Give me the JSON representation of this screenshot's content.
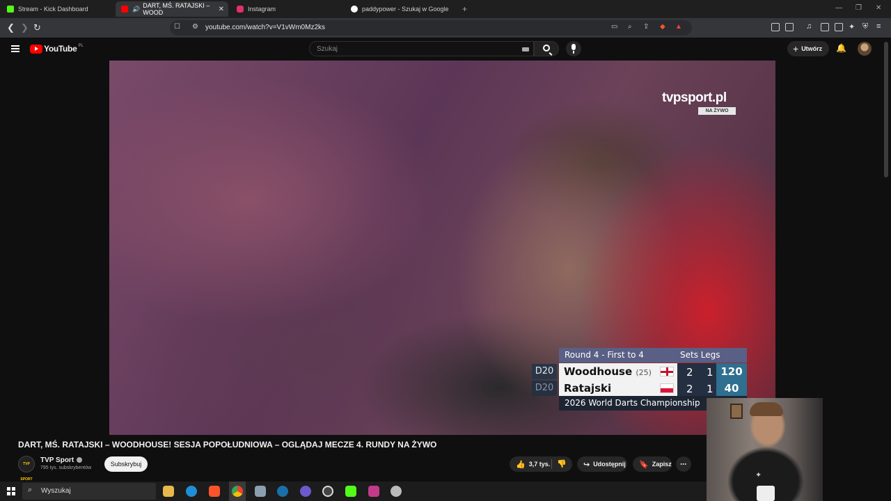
{
  "browser": {
    "tabs": [
      {
        "label": "Stream - Kick Dashboard",
        "color": "#53fc18"
      },
      {
        "label": "DART, MŚ. RATAJSKI – WOOD",
        "color": "#ff0000"
      },
      {
        "label": "Instagram",
        "color": "#e1306c"
      },
      {
        "label": "paddypower - Szukaj w Google",
        "color": "#4285f4"
      }
    ],
    "url": "youtube.com/watch?v=V1vWm0Mz2ks"
  },
  "youtube": {
    "logo": "YouTube",
    "country": "PL",
    "search_placeholder": "Szukaj",
    "create_label": "Utwórz"
  },
  "video": {
    "broadcaster": "tvpsport.pl",
    "live_badge": "NA ŻYWO",
    "scoreboard": {
      "round": "Round 4 - First to 4",
      "header_right": "Sets Legs",
      "footer": "2026 World Darts Championship",
      "players": [
        {
          "checkout": "D20",
          "name": "Woodhouse",
          "avg": "(25)",
          "flag": "England",
          "sets": "2",
          "legs": "1",
          "points": "120"
        },
        {
          "checkout": "D20",
          "name": "Ratajski",
          "avg": "",
          "flag": "Poland",
          "sets": "2",
          "legs": "1",
          "points": "40"
        }
      ]
    }
  },
  "meta": {
    "title": "DART, MŚ. RATAJSKI – WOODHOUSE! SESJA POPOŁUDNIOWA – OGLĄDAJ MECZE 4. RUNDY NA ŻYWO",
    "channel": "TVP Sport",
    "channel_avatar_text": "TVP SPORT",
    "subscribers": "795 tys. subskrybentów",
    "subscribe_label": "Subskrybuj",
    "likes": "3,7 tys.",
    "share_label": "Udostępnij",
    "save_label": "Zapisz"
  },
  "taskbar": {
    "search_label": "Wyszukaj",
    "apps": [
      "file-explorer-icon",
      "edge-icon",
      "brave-icon",
      "chrome-icon",
      "app-icon",
      "steam-icon",
      "discord-icon",
      "app-icon",
      "kick-icon",
      "app-icon",
      "app-icon"
    ]
  },
  "colors": {
    "accent": "#ff0000",
    "scoreboard_header": "#5a5f86",
    "score_points": "#2f6f8f"
  }
}
